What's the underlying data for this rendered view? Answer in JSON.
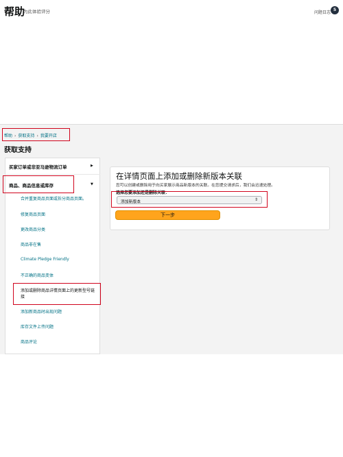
{
  "header": {
    "title": "帮助",
    "subtitle": "为此体验评分",
    "log_label": "问题日志",
    "log_count": "5"
  },
  "breadcrumb": [
    "帮助",
    "获取支持",
    "我要开店"
  ],
  "section_title": "获取支持",
  "sidebar": {
    "categories": [
      {
        "label": "买家订单或非亚马逊物流订单",
        "caret": "▶"
      },
      {
        "label": "商品、商品信息或库存",
        "caret": "▼"
      }
    ],
    "sub_items": [
      "合并重复商品页面或拆分商品页面。",
      "修复商品页面",
      "更改商品分类",
      "商品非在售",
      "Climate Pledge Friendly",
      "不正确的商品变体",
      "添加或删除商品详情页面上的更新型号链接",
      "添加新商品时出现问题",
      "库存文件上传问题",
      "商品评论"
    ]
  },
  "main": {
    "title": "在详情页面上添加或删除新版本关联",
    "description": "您可以创建或删除用于向买家展示商品新版本的关联。在您提交请求后，我们会迅速处理。",
    "select_label": "选择您要添加还是删除关联：",
    "select_value": "添加新版本",
    "next_label": "下一步"
  },
  "colors": {
    "accent": "#ffa41c",
    "link": "#007185",
    "annotation": "#d0021b"
  }
}
